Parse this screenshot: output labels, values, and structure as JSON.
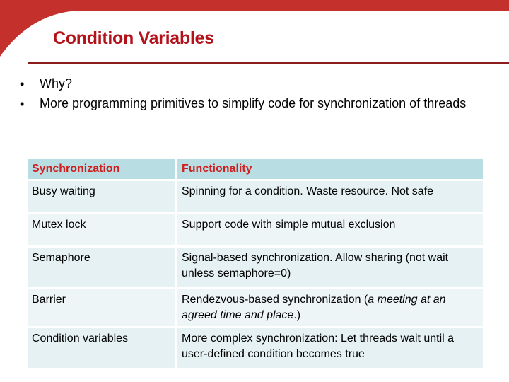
{
  "slide": {
    "title": "Condition Variables",
    "colors": {
      "accent": "#c4302b",
      "title": "#b3121a",
      "header_bg": "#b8dde3",
      "header_text": "#d01f1f"
    }
  },
  "bullets": [
    {
      "symbol": "•",
      "text": "Why?"
    },
    {
      "symbol": "•",
      "text": "More programming primitives to simplify code for  synchronization of threads"
    }
  ],
  "table": {
    "headers": [
      "Synchronization",
      "Functionality"
    ],
    "rows": [
      {
        "name": "Busy waiting",
        "desc": "Spinning for a condition. Waste resource. Not safe"
      },
      {
        "name": "Mutex lock",
        "desc": "Support code with simple mutual exclusion"
      },
      {
        "name": "Semaphore",
        "desc": "Signal-based synchronization. Allow sharing  (not wait unless semaphore=0)"
      },
      {
        "name": "Barrier",
        "desc_pre": "Rendezvous-based synchronization (",
        "desc_em": "a meeting at an agreed time and place",
        "desc_post": ".)"
      },
      {
        "name": "Condition variables",
        "desc": "More complex synchronization:  Let  threads wait until a user-defined condition becomes true"
      }
    ]
  }
}
